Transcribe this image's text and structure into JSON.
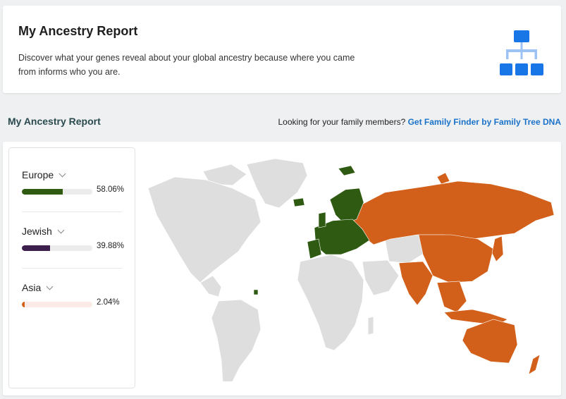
{
  "hero": {
    "title": "My Ancestry Report",
    "description": "Discover what your genes reveal about your global ancestry because where you came from informs who you are.",
    "icon": "org-chart-icon"
  },
  "section": {
    "title": "My Ancestry Report",
    "prompt": "Looking for your family members?",
    "link_label": "Get Family Finder by Family Tree DNA"
  },
  "regions": [
    {
      "label": "Europe",
      "percent_label": "58.06%",
      "percent": 58.06,
      "color": "#2f5a12",
      "track": "#ececec"
    },
    {
      "label": "Jewish",
      "percent_label": "39.88%",
      "percent": 39.88,
      "color": "#3d1f4e",
      "track": "#ececec"
    },
    {
      "label": "Asia",
      "percent_label": "2.04%",
      "percent": 2.04,
      "color": "#d2601a",
      "track": "#fbeae6"
    }
  ],
  "colors": {
    "land": "#dedede",
    "europe": "#2f5a12",
    "asia": "#d2601a",
    "link": "#1a73c9",
    "icon": "#1976e6"
  }
}
